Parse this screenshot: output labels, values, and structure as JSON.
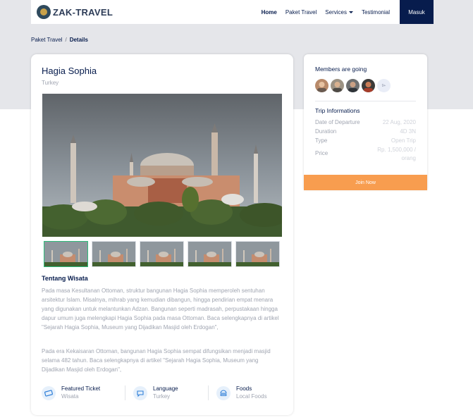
{
  "nav": {
    "brand": "ZAK-TRAVEL",
    "links": [
      "Home",
      "Paket Travel",
      "Services",
      "Testimonial"
    ],
    "login": "Masuk"
  },
  "breadcrumb": {
    "parent": "Paket Travel",
    "separator": "/",
    "current": "Details"
  },
  "detail": {
    "title": "Hagia Sophia",
    "location": "Turkey",
    "about_heading": "Tentang Wisata",
    "paragraph1": "Pada masa Kesultanan Ottoman, struktur bangunan Hagia Sophia memperoleh sentuhan arsitektur Islam. Misalnya, mihrab yang kemudian dibangun, hingga pendirian empat menara yang digunakan untuk melantunkan Adzan. Bangunan seperti madrasah, perpustakaan hingga dapur umum juga melengkapi Hagia Sophia pada masa Ottoman. Baca selengkapnya di artikel \"Sejarah Hagia Sophia, Museum yang Dijadikan Masjid oleh Erdogan\",",
    "paragraph2": "Pada era Kekaisaran Ottoman, bangunan Hagia Sophia sempat difungsikan menjadi masjid selama 482 tahun. Baca selengkapnya di artikel \"Sejarah Hagia Sophia, Museum yang Dijadikan Masjid oleh Erdogan\",",
    "features": [
      {
        "title": "Featured Ticket",
        "value": "Wisata",
        "icon": "ticket-icon"
      },
      {
        "title": "Language",
        "value": "Turkey",
        "icon": "chat-bubble-icon"
      },
      {
        "title": "Foods",
        "value": "Local Foods",
        "icon": "food-icon"
      }
    ]
  },
  "sidebar": {
    "members_heading": "Members are going",
    "more_members": "9+",
    "trip_heading": "Trip Informations",
    "trip": [
      {
        "label": "Date of Departure",
        "value": "22 Aug, 2020"
      },
      {
        "label": "Duration",
        "value": "4D 3N"
      },
      {
        "label": "Type",
        "value": "Open Trip"
      },
      {
        "label": "Price",
        "value": "Rp. 1,500,000 /",
        "value2": "orang"
      }
    ],
    "join": "Join Now"
  },
  "colors": {
    "navy": "#071c4d",
    "orange": "#f89d4f",
    "muted": "#a0a5b1",
    "green": "#2ebd7c"
  }
}
